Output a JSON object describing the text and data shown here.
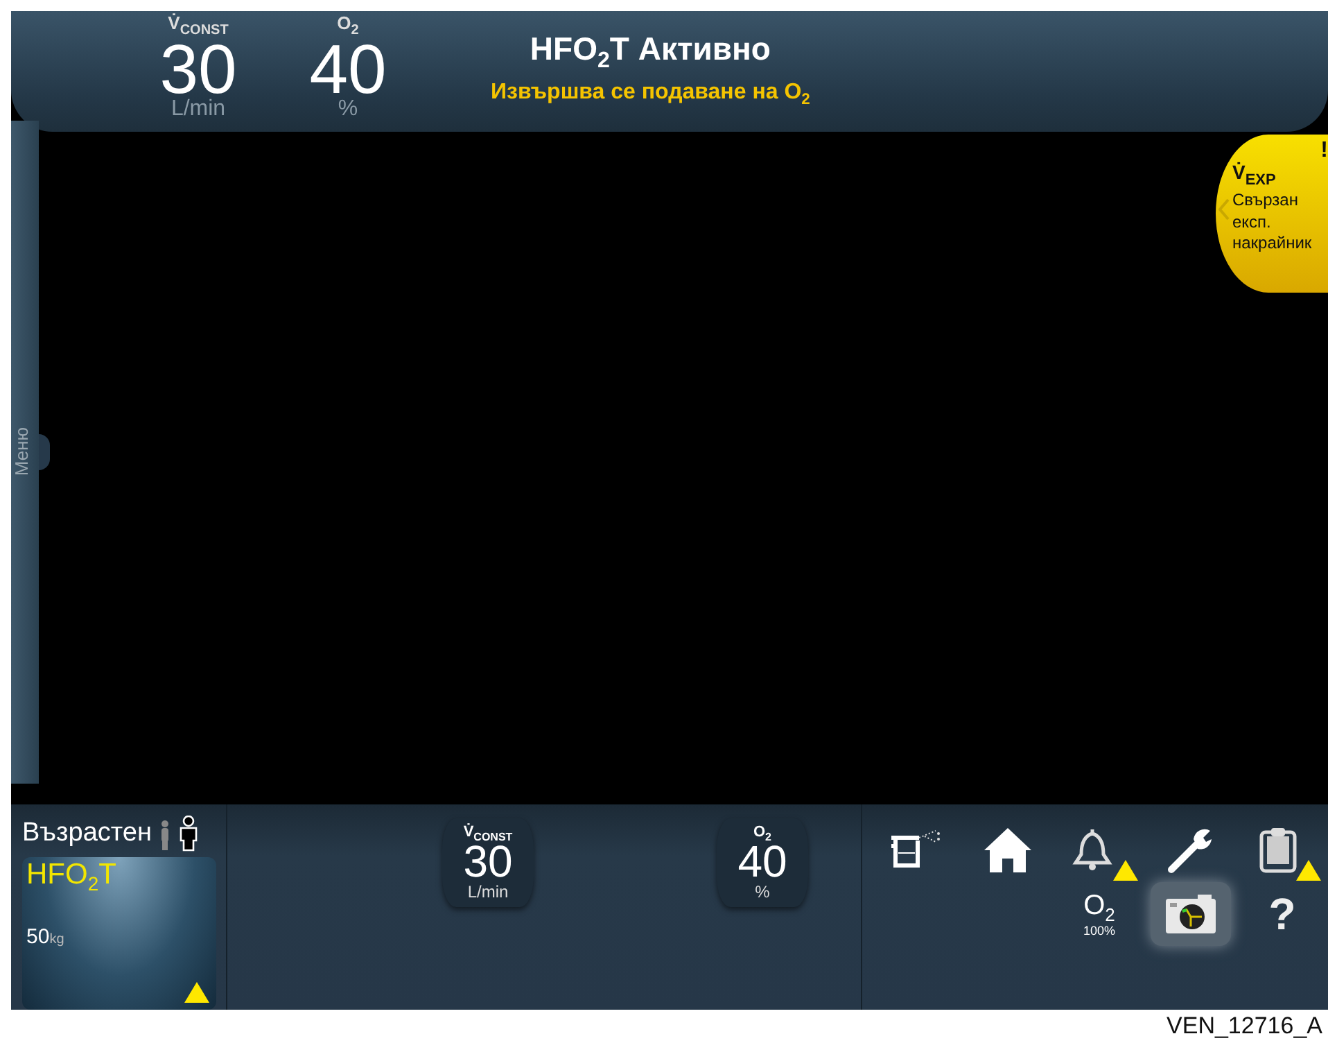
{
  "top_bar": {
    "settings": [
      {
        "label": "V̇$_{CONST}$",
        "value": "30",
        "unit": "L/min"
      },
      {
        "label": "O$_{2}$",
        "value": "40",
        "unit": "%"
      }
    ],
    "title": "HFO$_{2}$T Активно",
    "message": "Извършва се подаване на O$_{2}$"
  },
  "side_menu": {
    "label": "Меню"
  },
  "alarm_tab": {
    "marker": "!",
    "title": "V̇$_{EXP}$",
    "text": "Свързан експ. накрайник"
  },
  "patient": {
    "group": "Възрастен",
    "mode": "HFO$_{2}$T",
    "weight": "50",
    "weight_unit": "kg",
    "warning": true
  },
  "controls": [
    {
      "label": "V̇$_{CONST}$",
      "value": "30",
      "unit": "L/min"
    },
    {
      "label": "O$_{2}$",
      "value": "40",
      "unit": "%"
    }
  ],
  "toolbar": [
    {
      "kind": "nebulizer",
      "warning": false,
      "selected": false
    },
    {
      "kind": "home",
      "warning": false,
      "selected": false
    },
    {
      "kind": "alarms",
      "warning": true,
      "selected": false
    },
    {
      "kind": "tools",
      "warning": false,
      "selected": false
    },
    {
      "kind": "events",
      "warning": true,
      "selected": false
    },
    {
      "kind": "o2",
      "label": "O$_{2}$",
      "reading": "100%",
      "warning": false,
      "selected": false
    },
    {
      "kind": "screenshot",
      "warning": false,
      "selected": true
    },
    {
      "kind": "help",
      "label": "?",
      "warning": false,
      "selected": false
    }
  ],
  "caption": "VEN_12716_A"
}
